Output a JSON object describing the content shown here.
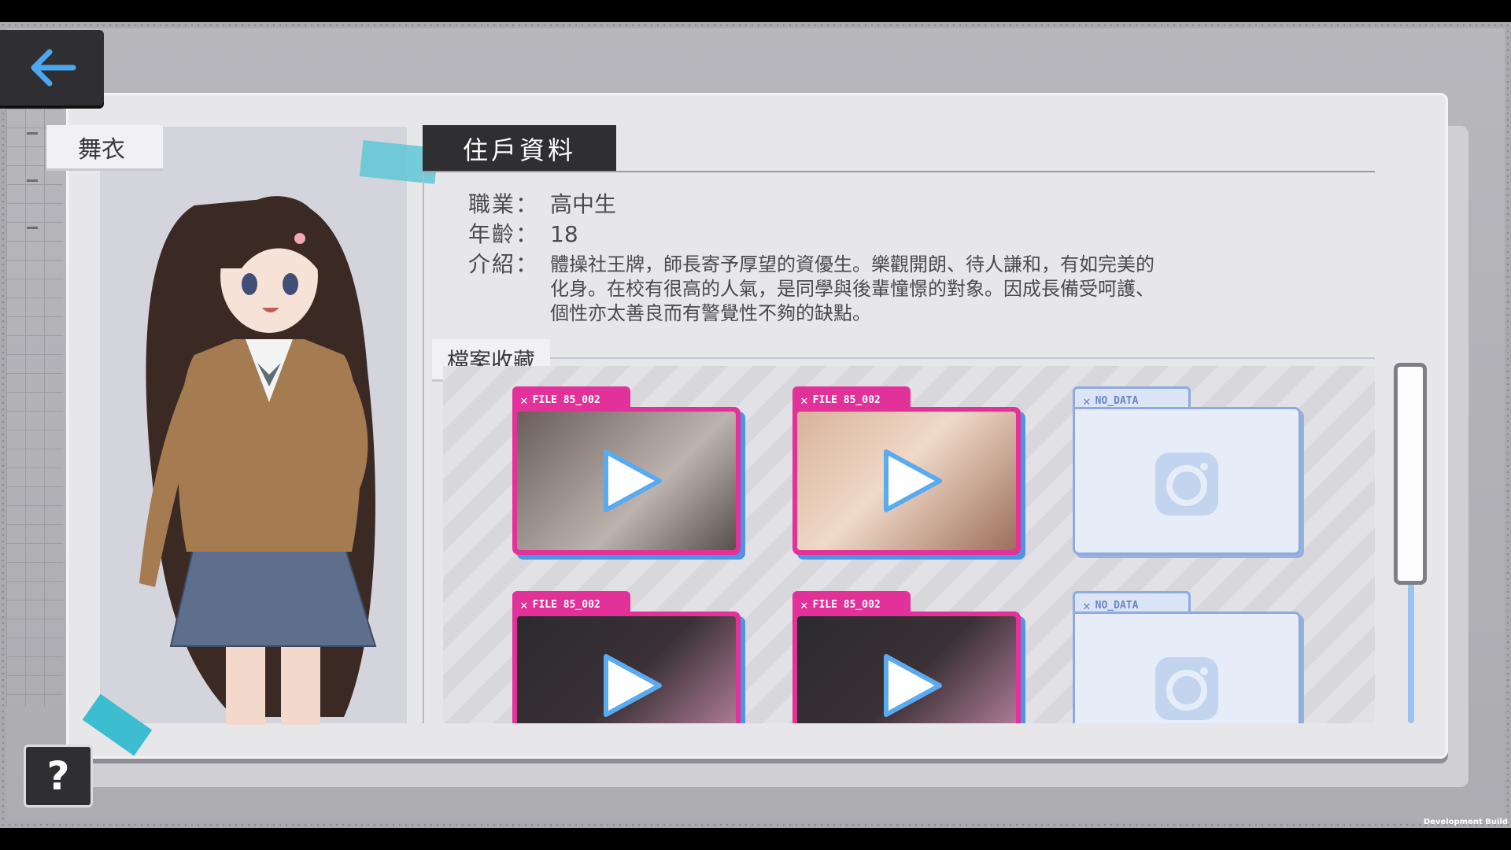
{
  "character": {
    "name": "舞衣"
  },
  "profile": {
    "section_title": "住戶資料",
    "occupation_label": "職業：",
    "occupation_value": "高中生",
    "age_label": "年齡：",
    "age_value": "18",
    "intro_label": "介紹：",
    "intro_lines": [
      "體操社王牌，師長寄予厚望的資優生。樂觀開朗、待人謙和，有如完美的",
      "化身。在校有很高的人氣，是同學與後輩憧憬的對象。因成長備受呵護、",
      "個性亦太善良而有警覺性不夠的缺點。"
    ]
  },
  "archive": {
    "title": "檔案收藏",
    "files": [
      {
        "label": "FILE 85_002",
        "state": "filled",
        "icon": "play-icon"
      },
      {
        "label": "FILE 85_002",
        "state": "filled",
        "icon": "play-icon"
      },
      {
        "label": "NO_DATA",
        "state": "empty",
        "icon": "camera-icon"
      },
      {
        "label": "FILE 85_002",
        "state": "filled",
        "icon": "play-icon"
      },
      {
        "label": "FILE 85_002",
        "state": "filled",
        "icon": "play-icon"
      },
      {
        "label": "NO_DATA",
        "state": "empty",
        "icon": "camera-icon"
      }
    ]
  },
  "buttons": {
    "back_icon": "back-arrow-icon",
    "help_label": "?"
  },
  "footer": {
    "dev_build": "Development Build"
  },
  "colors": {
    "accent_pink": "#e3319a",
    "accent_blue": "#4c95e3",
    "dark_panel": "#2f2f33",
    "tape_cyan": "#55c6d4"
  }
}
